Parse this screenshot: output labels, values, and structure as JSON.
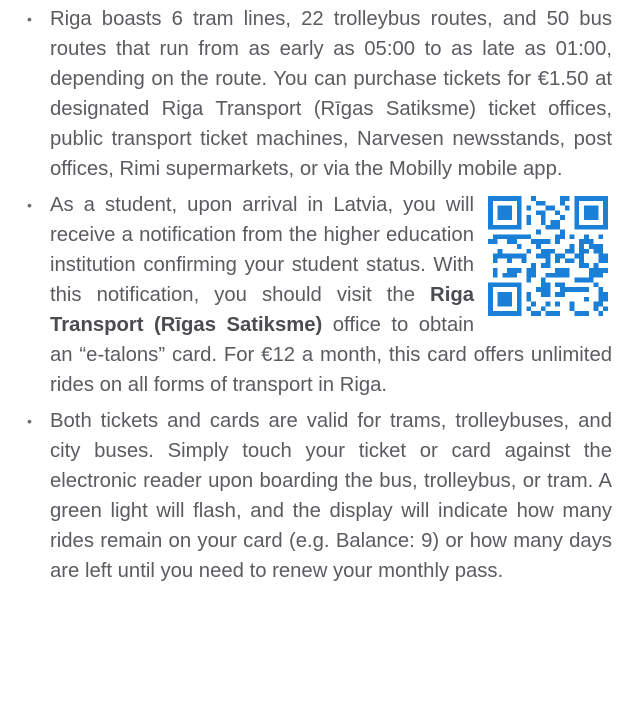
{
  "items": [
    {
      "bullet": "•",
      "text": "Riga boasts 6 tram lines, 22 trolleybus routes, and 50 bus routes that run from as early as 05:00 to as late as 01:00, depending on the route. You can purchase tickets for €1.50 at designated Riga Transport (Rīgas Satiksme) ticket offices, public transport ticket machines, Narvesen newsstands, post offices, Rimi supermarkets, or via the Mobilly mobile app."
    },
    {
      "bullet": "•",
      "text_before": "As a student, upon arrival in Latvia, you will receive a notification from the higher education institution confirming your student status. With this notification, you should visit the ",
      "bold": "Riga Transport (Rīgas Satiksme)",
      "text_after": " office to obtain an “e-talons” card. For €12 a month, this card offers unlimited rides on all forms of transport in Riga.",
      "qr_icon": "qr-code-icon",
      "qr_color": "#1a7fd6"
    },
    {
      "bullet": "•",
      "text": "Both tickets and cards are valid for trams, trolleybuses, and city buses. Simply touch your ticket or card against the electronic reader upon boarding the bus, trolleybus, or tram. A green light will flash, and the display will indicate how many rides remain on your card (e.g. Balance: 9) or how many days are left until you need to renew your monthly pass."
    }
  ]
}
